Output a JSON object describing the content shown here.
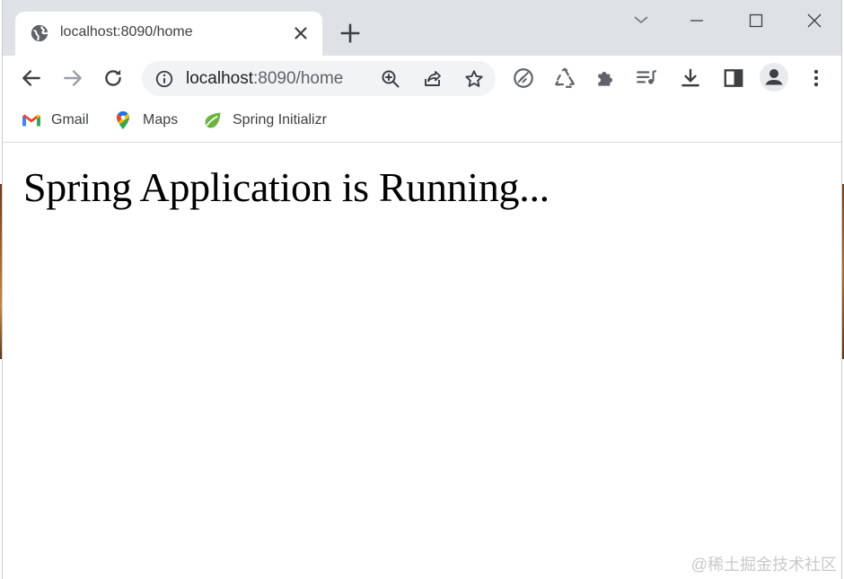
{
  "tab": {
    "title": "localhost:8090/home"
  },
  "omnibox": {
    "host": "localhost",
    "path": ":8090/home"
  },
  "bookmarks": [
    {
      "label": "Gmail"
    },
    {
      "label": "Maps"
    },
    {
      "label": "Spring Initializr"
    }
  ],
  "page": {
    "heading": "Spring Application is Running..."
  },
  "watermark": "@稀土掘金技术社区",
  "colors": {
    "tabstrip": "#dee1e6",
    "omnibox": "#f1f3f4",
    "icon": "#5f6368",
    "spring_green": "#6db33f"
  }
}
